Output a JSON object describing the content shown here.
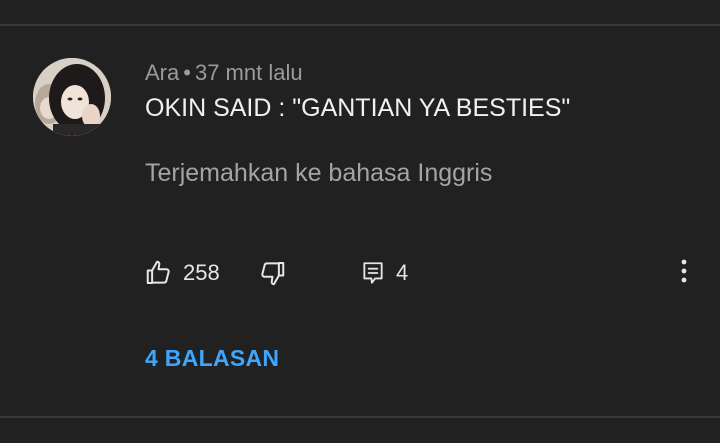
{
  "comment": {
    "author": "Ara",
    "separator": "•",
    "time": "37 mnt lalu",
    "text": "OKIN SAID : \"GANTIAN YA BESTIES\"",
    "translate_label": "Terjemahkan ke bahasa Inggris",
    "likes": "258",
    "replies_count": "4",
    "replies_label": "4 BALASAN"
  },
  "icons": {
    "like": "thumbs-up-icon",
    "dislike": "thumbs-down-icon",
    "reply": "comment-icon",
    "more": "more-vertical-icon"
  },
  "colors": {
    "background": "#212121",
    "primary_text": "#f1f1f1",
    "secondary_text": "#9b9b9b",
    "link_blue": "#3ea6ff"
  }
}
